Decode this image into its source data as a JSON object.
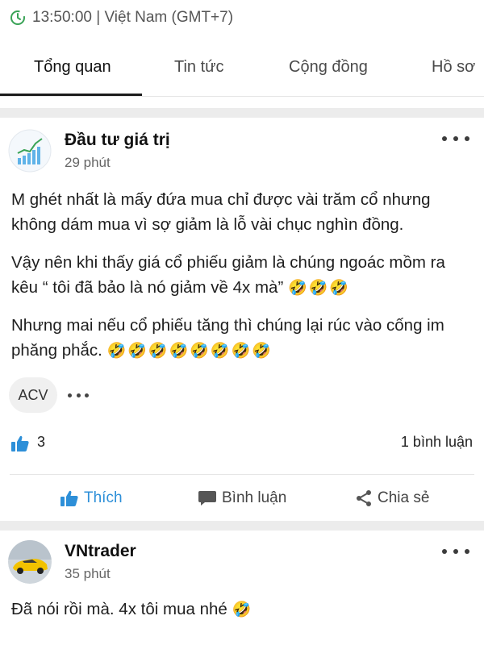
{
  "status_bar": {
    "time_zone_text": "13:50:00 | Việt Nam (GMT+7)"
  },
  "tabs": [
    {
      "label": "Tổng quan",
      "active": true
    },
    {
      "label": "Tin tức"
    },
    {
      "label": "Cộng đồng"
    },
    {
      "label": "Hồ sơ"
    }
  ],
  "posts": [
    {
      "author": "Đầu tư giá trị",
      "time": "29 phút",
      "paragraphs": [
        "M ghét nhất là mấy đứa mua chỉ được vài trăm cổ nhưng không dám mua vì sợ giảm là lỗ vài chục nghìn đồng.",
        "Vậy nên khi thấy giá cổ phiếu giảm là chúng ngoác mồm ra kêu “ tôi đã bảo là nó giảm về 4x mà” ",
        "Nhưng mai nếu cổ phiếu tăng thì chúng lại rúc vào cống im phăng phắc. "
      ],
      "paragraph_emojis": [
        "",
        "🤣🤣🤣",
        "🤣🤣🤣🤣🤣🤣🤣🤣"
      ],
      "tag": "ACV",
      "like_count": "3",
      "comment_count": "1 bình luận",
      "actions": {
        "like": "Thích",
        "comment": "Bình luận",
        "share": "Chia sẻ"
      }
    },
    {
      "author": "VNtrader",
      "time": "35 phút",
      "text": "Đã nói rồi mà. 4x tôi mua nhé ",
      "emoji": "🤣"
    }
  ],
  "colors": {
    "accent_blue": "#2d8fd8",
    "divider_band": "#ececec"
  },
  "icons": [
    "clock-icon",
    "more-icon",
    "thumbs-up-icon",
    "comment-icon",
    "share-icon"
  ]
}
